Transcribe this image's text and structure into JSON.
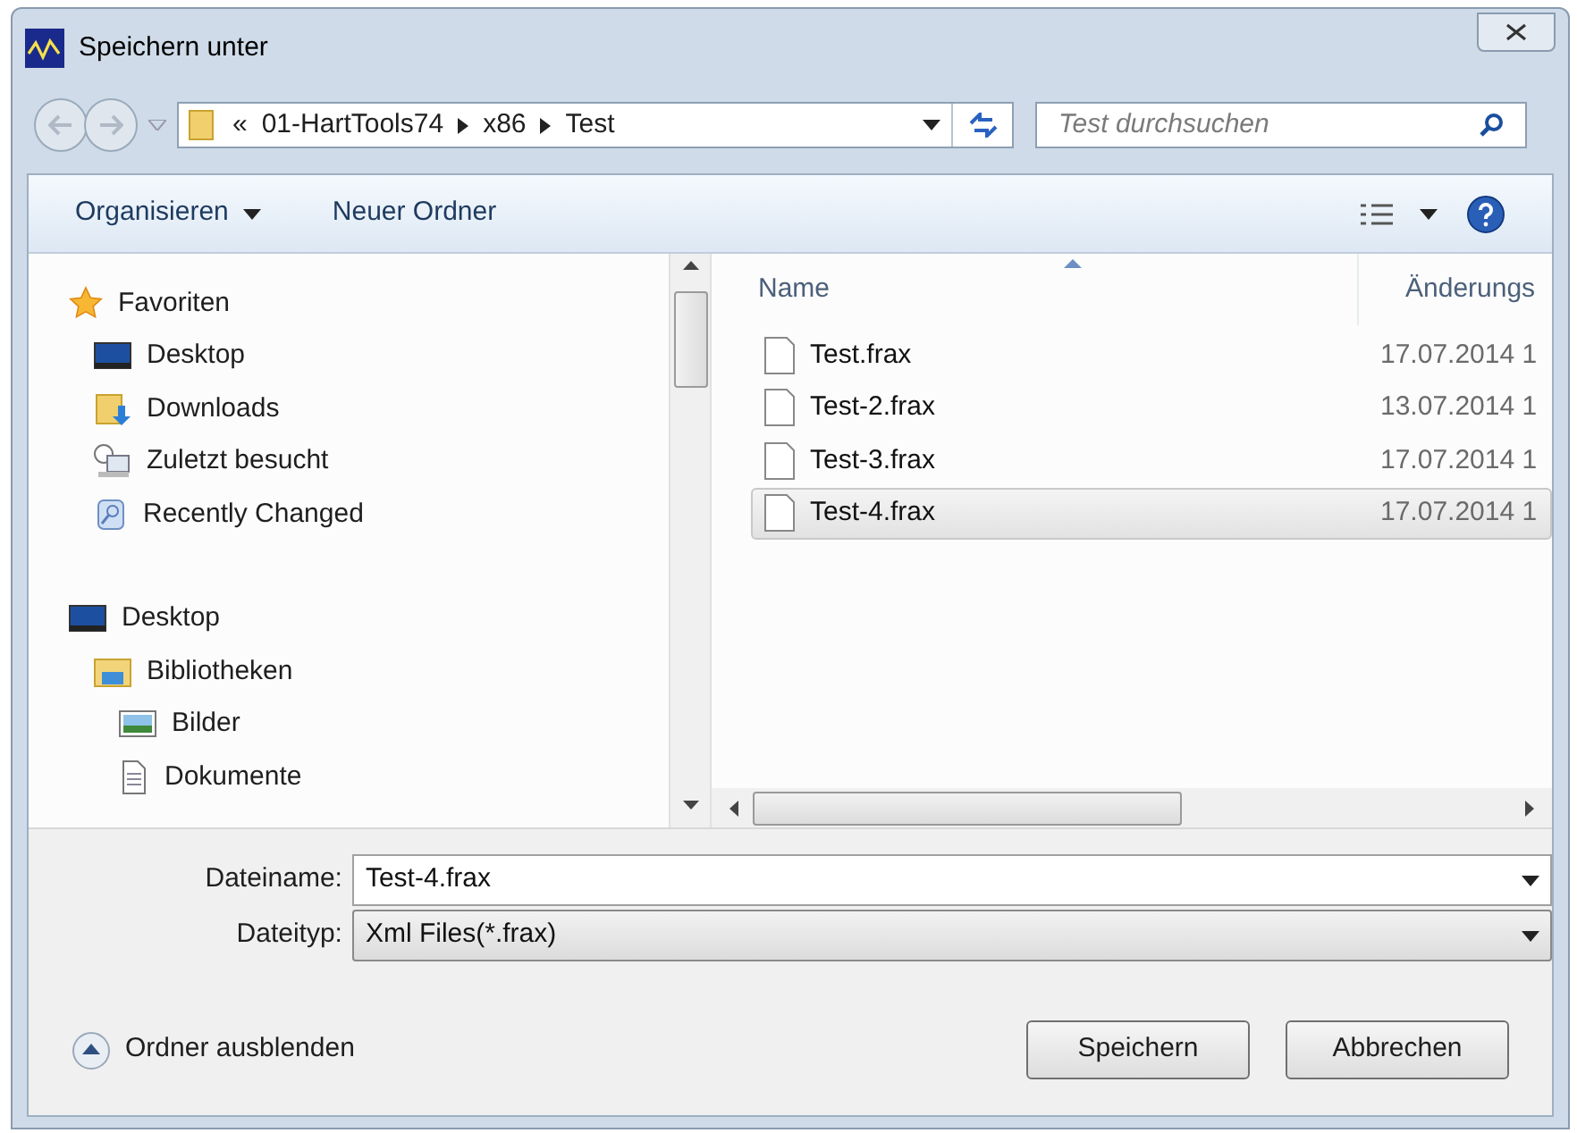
{
  "window": {
    "title": "Speichern unter"
  },
  "address": {
    "crumbs": [
      "«",
      "01-HartTools74",
      "x86",
      "Test"
    ]
  },
  "search": {
    "placeholder": "Test durchsuchen"
  },
  "toolbar": {
    "buttons": [
      {
        "label": "Organisieren",
        "dropdown": true
      },
      {
        "label": "Neuer Ordner",
        "dropdown": false
      }
    ]
  },
  "tree": {
    "items": [
      {
        "label": "Favoriten",
        "kind": "star",
        "children": [
          {
            "label": "Desktop",
            "kind": "desktop"
          },
          {
            "label": "Downloads",
            "kind": "downloads"
          },
          {
            "label": "Zuletzt besucht",
            "kind": "recent"
          },
          {
            "label": "Recently Changed",
            "kind": "changed"
          }
        ]
      },
      {
        "label": "Desktop",
        "kind": "desktop",
        "children": [
          {
            "label": "Bibliotheken",
            "kind": "libraries",
            "children": [
              {
                "label": "Bilder",
                "kind": "pictures"
              },
              {
                "label": "Dokumente",
                "kind": "documents"
              }
            ]
          }
        ]
      }
    ]
  },
  "files": {
    "columns": [
      "Name",
      "Änderungs"
    ],
    "rows": [
      {
        "name": "Test.frax",
        "date": "17.07.2014 1",
        "selected": false
      },
      {
        "name": "Test-2.frax",
        "date": "13.07.2014 1",
        "selected": false
      },
      {
        "name": "Test-3.frax",
        "date": "17.07.2014 1",
        "selected": false
      },
      {
        "name": "Test-4.frax",
        "date": "17.07.2014 1",
        "selected": true
      }
    ]
  },
  "form": {
    "filename_label": "Dateiname:",
    "filename": "Test-4.frax",
    "filetype_label": "Dateityp:",
    "filetype": "Xml Files(*.frax)"
  },
  "footer": {
    "toggle": "Ordner ausblenden",
    "buttons": [
      "Speichern",
      "Abbrechen"
    ]
  }
}
